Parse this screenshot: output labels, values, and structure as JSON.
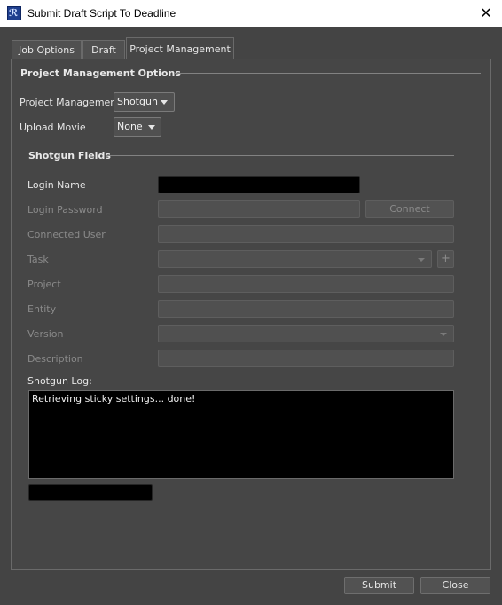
{
  "window": {
    "title": "Submit Draft Script To Deadline",
    "close_glyph": "✕"
  },
  "tabs": [
    {
      "label": "Job Options"
    },
    {
      "label": "Draft"
    },
    {
      "label": "Project Management",
      "active": true
    }
  ],
  "pm_options": {
    "title": "Project Management Options",
    "project_management_label": "Project Management",
    "project_management_value": "Shotgun",
    "upload_movie_label": "Upload Movie",
    "upload_movie_value": "None"
  },
  "shotgun": {
    "title": "Shotgun Fields",
    "login_name_label": "Login Name",
    "login_name_value": "",
    "login_password_label": "Login Password",
    "connect_label": "Connect",
    "connected_user_label": "Connected User",
    "task_label": "Task",
    "add_task_glyph": "+",
    "project_label": "Project",
    "entity_label": "Entity",
    "version_label": "Version",
    "description_label": "Description",
    "log_label": "Shotgun Log:",
    "log_text": "Retrieving sticky settings... done!"
  },
  "footer": {
    "submit_label": "Submit",
    "close_label": "Close"
  },
  "colors": {
    "background": "#444444",
    "field_black": "#000000",
    "panel": "#464646"
  }
}
